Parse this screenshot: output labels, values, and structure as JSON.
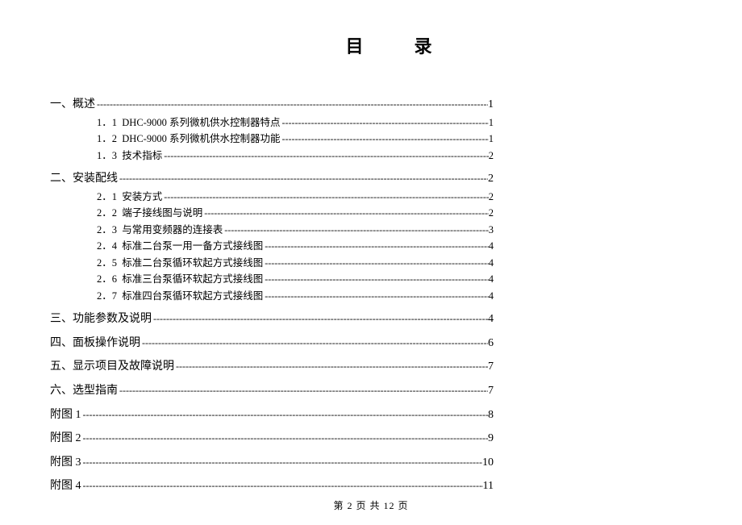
{
  "title": {
    "c1": "目",
    "c2": "录"
  },
  "toc": {
    "s1": {
      "num": "一、",
      "label": "概述",
      "page": "1",
      "items": [
        {
          "num": "1．1",
          "label": "DHC-9000 系列微机供水控制器特点",
          "page": "1"
        },
        {
          "num": "1．2",
          "label": "DHC-9000 系列微机供水控制器功能",
          "page": "1"
        },
        {
          "num": "1．3",
          "label": "技术指标",
          "page": "2"
        }
      ]
    },
    "s2": {
      "num": "二、",
      "label": " 安装配线",
      "page": "2",
      "items": [
        {
          "num": "2．1",
          "label": "安装方式",
          "page": "2"
        },
        {
          "num": "2．2",
          "label": "端子接线图与说明",
          "page": "2"
        },
        {
          "num": "2．3",
          "label": "与常用变频器的连接表",
          "page": "3"
        },
        {
          "num": "2．4",
          "label": "标准二台泵一用一备方式接线图",
          "page": "4"
        },
        {
          "num": "2．5",
          "label": "标准二台泵循环软起方式接线图",
          "page": "4"
        },
        {
          "num": "2．6",
          "label": "标准三台泵循环软起方式接线图",
          "page": "4"
        },
        {
          "num": "2．7",
          "label": "标准四台泵循环软起方式接线图",
          "page": "4"
        }
      ]
    },
    "s3": {
      "num": "三、",
      "label": "功能参数及说明",
      "page": "4"
    },
    "s4": {
      "num": "四、",
      "label": "面板操作说明",
      "page": "6"
    },
    "s5": {
      "num": "五、",
      "label": "显示项目及故障说明",
      "page": "7"
    },
    "s6": {
      "num": "六、",
      "label": "选型指南",
      "page": "7"
    },
    "a1": {
      "label": "附图 1",
      "page": "8"
    },
    "a2": {
      "label": "附图 2",
      "page": "9"
    },
    "a3": {
      "label": "附图 3",
      "page": "10"
    },
    "a4": {
      "label": "附图 4",
      "page": "11"
    }
  },
  "footer": {
    "prefix": "第",
    "cur": "2",
    "mid": "页 共",
    "total": "12",
    "suffix": "页"
  }
}
